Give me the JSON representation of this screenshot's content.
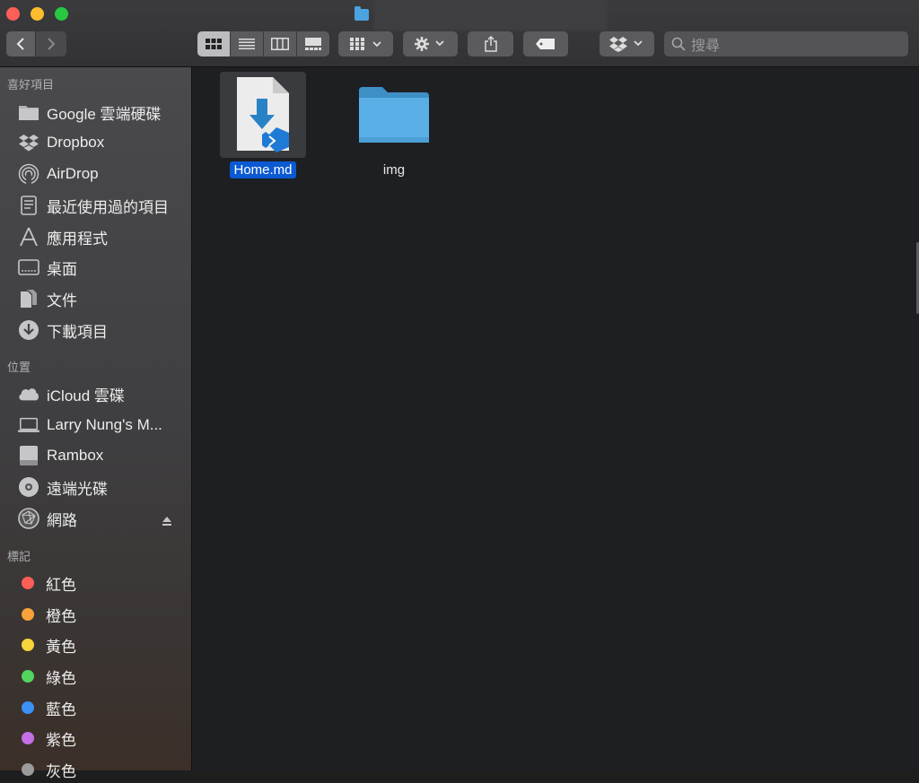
{
  "window": {
    "title": ""
  },
  "toolbar": {
    "search_placeholder": "搜尋",
    "view_modes": [
      "icon-view",
      "list-view",
      "column-view",
      "gallery-view"
    ],
    "active_view": "icon-view"
  },
  "sidebar": {
    "favorites_header": "喜好項目",
    "favorites": [
      {
        "label": "Google 雲端硬碟",
        "icon": "drive-folder-icon"
      },
      {
        "label": "Dropbox",
        "icon": "dropbox-icon"
      },
      {
        "label": "AirDrop",
        "icon": "airdrop-icon"
      },
      {
        "label": "最近使用過的項目",
        "icon": "recents-icon"
      },
      {
        "label": "應用程式",
        "icon": "applications-icon"
      },
      {
        "label": "桌面",
        "icon": "desktop-icon"
      },
      {
        "label": "文件",
        "icon": "documents-icon"
      },
      {
        "label": "下載項目",
        "icon": "downloads-icon"
      }
    ],
    "locations_header": "位置",
    "locations": [
      {
        "label": "iCloud 雲碟",
        "icon": "icloud-icon"
      },
      {
        "label": "Larry Nung's M...",
        "icon": "laptop-icon"
      },
      {
        "label": "Rambox",
        "icon": "disk-icon"
      },
      {
        "label": "遠端光碟",
        "icon": "optical-disc-icon"
      },
      {
        "label": "網路",
        "icon": "network-icon"
      }
    ],
    "tags_header": "標記",
    "tags": [
      {
        "label": "紅色",
        "color": "#fe5f57"
      },
      {
        "label": "橙色",
        "color": "#f9a13a"
      },
      {
        "label": "黃色",
        "color": "#f7d43a"
      },
      {
        "label": "綠色",
        "color": "#52d45f"
      },
      {
        "label": "藍色",
        "color": "#3b8ff5"
      },
      {
        "label": "紫色",
        "color": "#c56ee6"
      },
      {
        "label": "灰色",
        "color": "#9b9b9b"
      }
    ]
  },
  "files": [
    {
      "name": "Home.md",
      "selected": true,
      "icon": "markdown-file-icon"
    },
    {
      "name": "img",
      "selected": false,
      "icon": "folder-icon"
    }
  ],
  "colors": {
    "selection": "#0b5ad3",
    "folder": "#4aa3df"
  }
}
